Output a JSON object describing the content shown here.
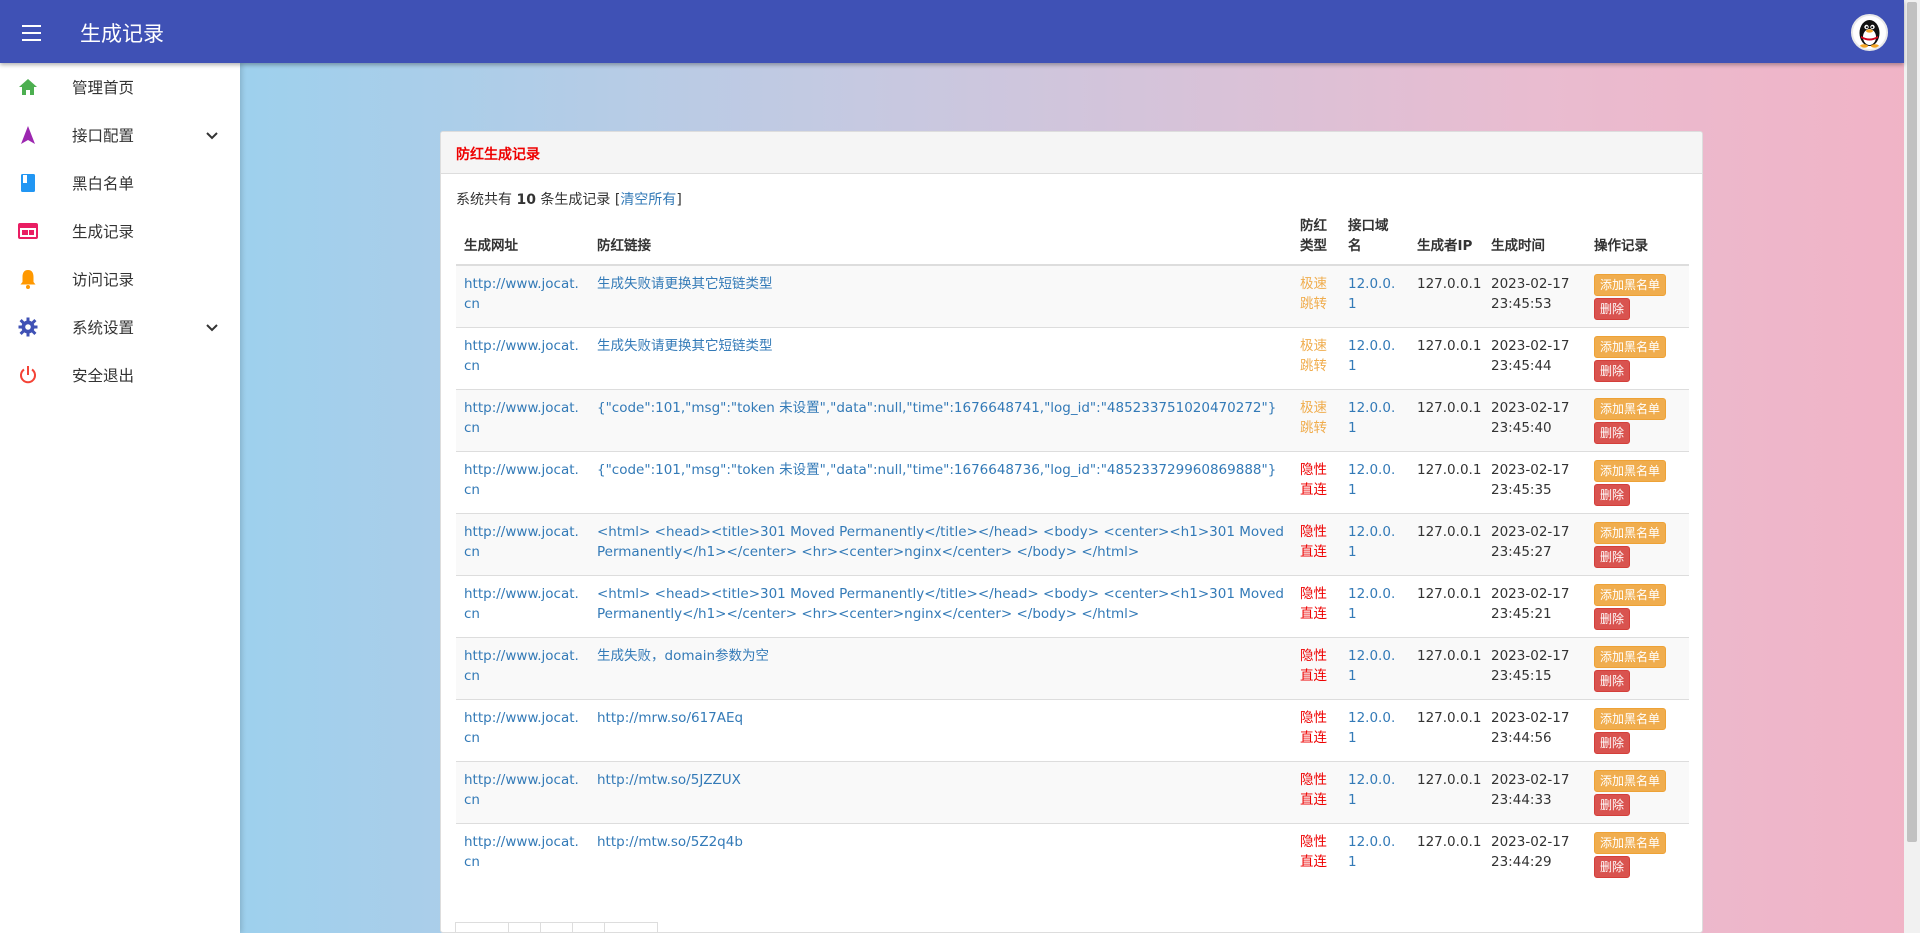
{
  "header": {
    "title": "生成记录"
  },
  "sidebar": {
    "items": [
      {
        "label": "管理首页",
        "color": "#4caf50"
      },
      {
        "label": "接口配置",
        "color": "#9c27b0"
      },
      {
        "label": "黑白名单",
        "color": "#2196f3"
      },
      {
        "label": "生成记录",
        "color": "#e91e63"
      },
      {
        "label": "访问记录",
        "color": "#ff9800"
      },
      {
        "label": "系统设置",
        "color": "#3f51b5"
      },
      {
        "label": "安全退出",
        "color": "#f44336"
      }
    ]
  },
  "panel": {
    "title": "防红生成记录",
    "summary_prefix": "系统共有",
    "summary_count": "10",
    "summary_suffix": "条生成记录",
    "clear_label": "清空所有"
  },
  "table": {
    "headers": [
      "生成网址",
      "防红链接",
      "防红类型",
      "接口域名",
      "生成者IP",
      "生成时间",
      "操作记录"
    ],
    "add_blacklist_label": "添加黑名单",
    "delete_label": "删除",
    "rows": [
      {
        "url": "http://www.jocat.cn",
        "link": "生成失败请更换其它短链类型",
        "type": "极速跳转",
        "api": "12.0.0.1",
        "ip": "127.0.0.1",
        "date": "2023-02-17",
        "time": "23:45:53"
      },
      {
        "url": "http://www.jocat.cn",
        "link": "生成失败请更换其它短链类型",
        "type": "极速跳转",
        "api": "12.0.0.1",
        "ip": "127.0.0.1",
        "date": "2023-02-17",
        "time": "23:45:44"
      },
      {
        "url": "http://www.jocat.cn",
        "link": "{\"code\":101,\"msg\":\"token 未设置\",\"data\":null,\"time\":1676648741,\"log_id\":\"485233751020470272\"}",
        "type": "极速跳转",
        "api": "12.0.0.1",
        "ip": "127.0.0.1",
        "date": "2023-02-17",
        "time": "23:45:40"
      },
      {
        "url": "http://www.jocat.cn",
        "link": "{\"code\":101,\"msg\":\"token 未设置\",\"data\":null,\"time\":1676648736,\"log_id\":\"485233729960869888\"}",
        "type": "隐性直连",
        "api": "12.0.0.1",
        "ip": "127.0.0.1",
        "date": "2023-02-17",
        "time": "23:45:35"
      },
      {
        "url": "http://www.jocat.cn",
        "link": "<html> <head><title>301 Moved Permanently</title></head> <body> <center><h1>301 Moved Permanently</h1></center> <hr><center>nginx</center> </body> </html>",
        "type": "隐性直连",
        "api": "12.0.0.1",
        "ip": "127.0.0.1",
        "date": "2023-02-17",
        "time": "23:45:27"
      },
      {
        "url": "http://www.jocat.cn",
        "link": "<html> <head><title>301 Moved Permanently</title></head> <body> <center><h1>301 Moved Permanently</h1></center> <hr><center>nginx</center> </body> </html>",
        "type": "隐性直连",
        "api": "12.0.0.1",
        "ip": "127.0.0.1",
        "date": "2023-02-17",
        "time": "23:45:21"
      },
      {
        "url": "http://www.jocat.cn",
        "link": "生成失败，domain参数为空",
        "type": "隐性直连",
        "api": "12.0.0.1",
        "ip": "127.0.0.1",
        "date": "2023-02-17",
        "time": "23:45:15"
      },
      {
        "url": "http://www.jocat.cn",
        "link": "http://mrw.so/617AEq",
        "type": "隐性直连",
        "api": "12.0.0.1",
        "ip": "127.0.0.1",
        "date": "2023-02-17",
        "time": "23:44:56"
      },
      {
        "url": "http://www.jocat.cn",
        "link": "http://mtw.so/5JZZUX",
        "type": "隐性直连",
        "api": "12.0.0.1",
        "ip": "127.0.0.1",
        "date": "2023-02-17",
        "time": "23:44:33"
      },
      {
        "url": "http://www.jocat.cn",
        "link": "http://mtw.so/5Z2q4b",
        "type": "隐性直连",
        "api": "12.0.0.1",
        "ip": "127.0.0.1",
        "date": "2023-02-17",
        "time": "23:44:29"
      }
    ]
  }
}
